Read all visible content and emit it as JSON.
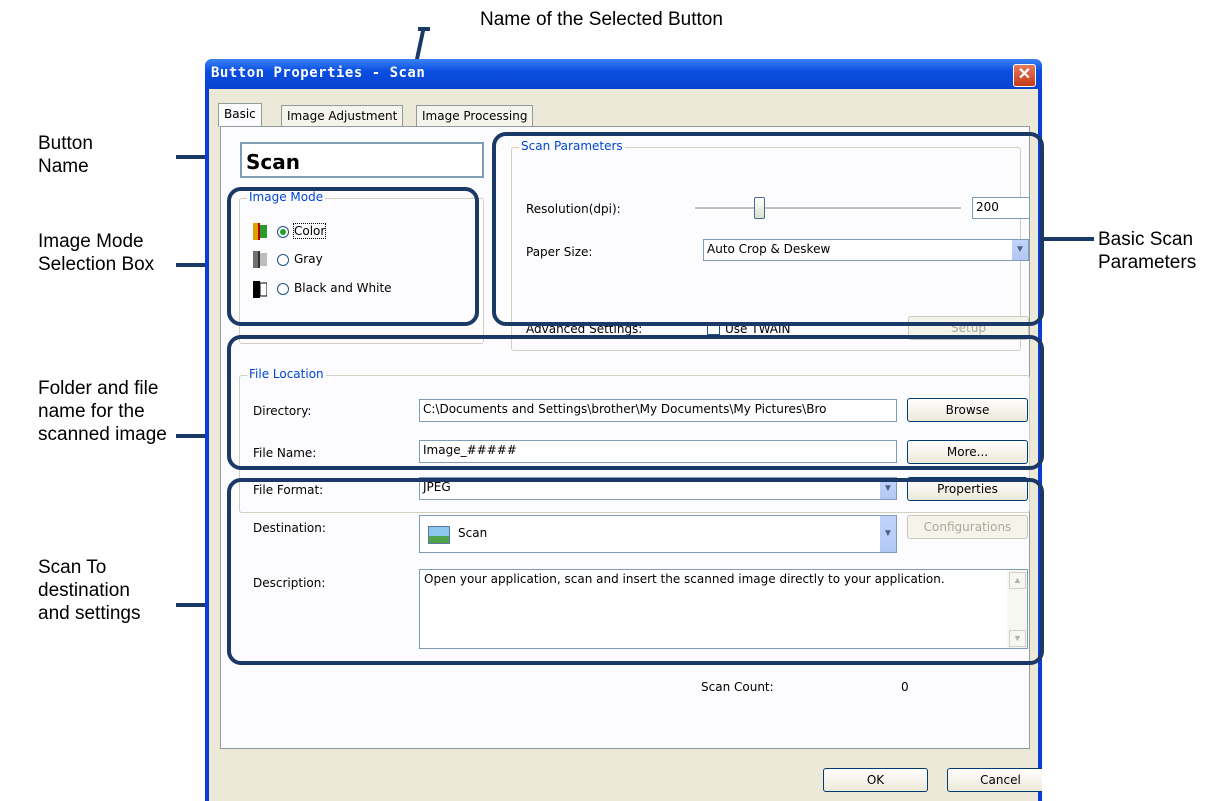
{
  "callouts": {
    "selected_button_name": "Name of the Selected Button",
    "button_name_l1": "Button",
    "button_name_l2": "Name",
    "image_mode_l1": "Image Mode",
    "image_mode_l2": "Selection Box",
    "folder_l1": "Folder and file",
    "folder_l2": "name for the",
    "folder_l3": "scanned image",
    "scanto_l1": "Scan To",
    "scanto_l2": "destination",
    "scanto_l3": "and settings",
    "basic_l1": "Basic Scan",
    "basic_l2": "Parameters"
  },
  "dialog": {
    "title": "Button Properties - Scan",
    "close_symbol": "✕"
  },
  "tabs": [
    {
      "label": "Basic"
    },
    {
      "label": "Image Adjustment"
    },
    {
      "label": "Image Processing"
    }
  ],
  "button_name_value": "Scan",
  "image_mode": {
    "label": "Image Mode",
    "options": [
      {
        "label": "Color",
        "selected": true
      },
      {
        "label": "Gray",
        "selected": false
      },
      {
        "label": "Black and White",
        "selected": false
      }
    ]
  },
  "scan_parameters": {
    "label": "Scan Parameters",
    "resolution_label": "Resolution(dpi):",
    "resolution_value": "200",
    "resolution_slider_fraction": 0.24,
    "paper_size_label": "Paper Size:",
    "paper_size_value": "Auto Crop & Deskew",
    "advanced_label": "Advanced Settings:",
    "use_twain_label": "Use TWAIN",
    "use_twain_checked": false,
    "setup_button": "Setup"
  },
  "file_location": {
    "label": "File Location",
    "directory_label": "Directory:",
    "directory_value": "C:\\Documents and Settings\\brother\\My Documents\\My Pictures\\Bro",
    "browse_button": "Browse",
    "file_name_label": "File Name:",
    "file_name_value": "Image_#####",
    "more_button": "More...",
    "file_format_label": "File Format:",
    "file_format_value": "JPEG",
    "properties_button": "Properties"
  },
  "destination": {
    "label": "Destination:",
    "value": "Scan",
    "configurations_button": "Configurations",
    "description_label": "Description:",
    "description_value": "Open your application, scan and insert the scanned image directly to your application.",
    "scan_count_label": "Scan Count:",
    "scan_count_value": "0"
  },
  "footer": {
    "ok_button": "OK",
    "cancel_button": "Cancel"
  },
  "colors": {
    "highlight": "#1a3966",
    "titlebar": "#0a4fe0",
    "dialog_bg": "#ece9d8",
    "color_icon": "#e0a000"
  }
}
